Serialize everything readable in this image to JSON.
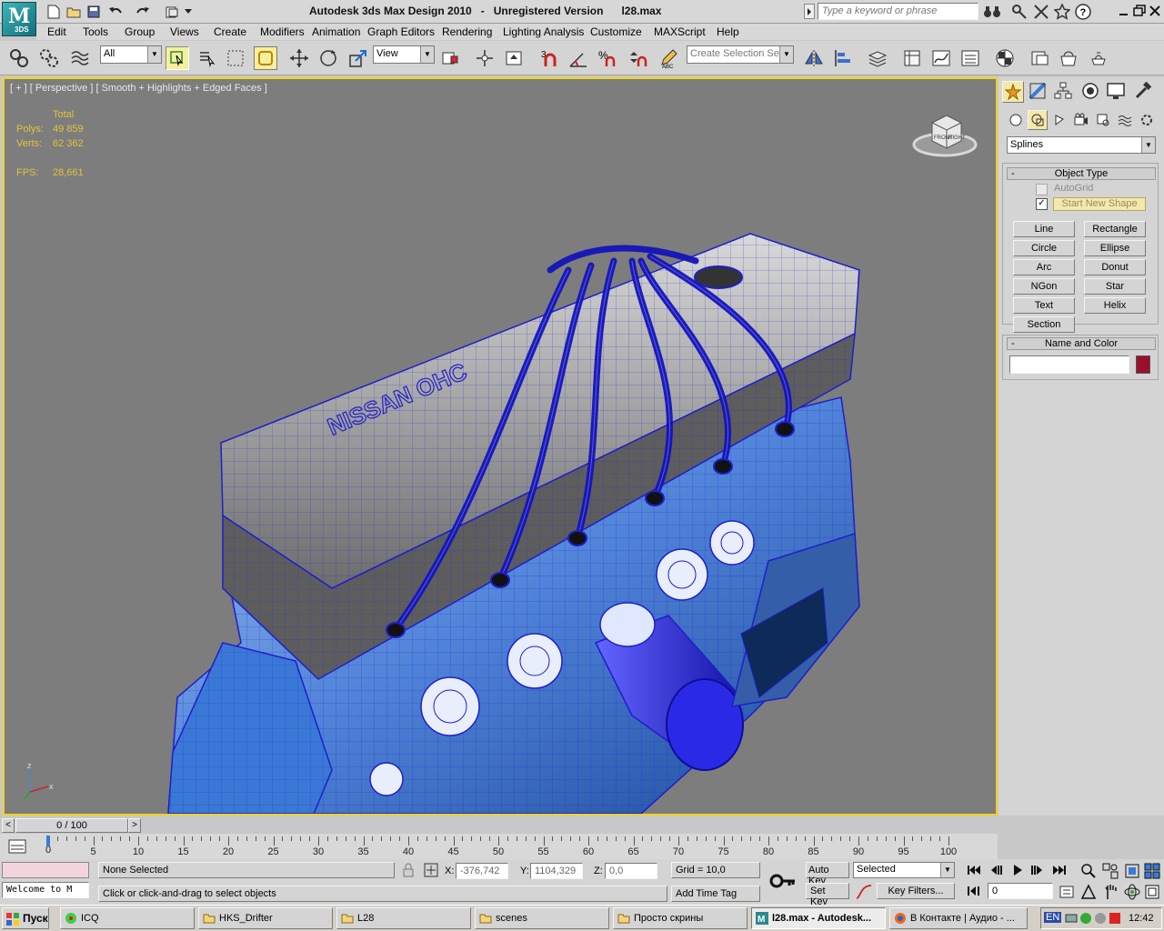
{
  "window": {
    "title": "Autodesk 3ds Max Design 2010   -   Unregistered Version      l28.max",
    "logo_text": "M",
    "logo_sub": "3DS",
    "search_placeholder": "Type a keyword or phrase"
  },
  "menu": [
    "Edit",
    "Tools",
    "Group",
    "Views",
    "Create",
    "Modifiers",
    "Animation",
    "Graph Editors",
    "Rendering",
    "Lighting Analysis",
    "Customize",
    "MAXScript",
    "Help"
  ],
  "toolbar": {
    "selection_filter": "All",
    "ref_coord": "View",
    "named_selection_placeholder": "Create Selection Se",
    "snap_3": "3",
    "angle_snap": "%"
  },
  "viewport": {
    "label": "[ + ] [ Perspective ] [ Smooth + Highlights + Edged Faces ]",
    "stats": {
      "total_label": "Total",
      "polys_label": "Polys:",
      "polys": "49 859",
      "verts_label": "Verts:",
      "verts": "62 362",
      "fps_label": "FPS:",
      "fps": "28,661"
    },
    "model_text": "NISSAN OHC",
    "axis_z": "z",
    "axis_x": "x",
    "viewcube_front": "FRONT",
    "viewcube_right": "RIGHT"
  },
  "command_panel": {
    "category": "Splines",
    "object_type_title": "Object Type",
    "autogrid": "AutoGrid",
    "start_new_shape": "Start New Shape",
    "buttons": [
      "Line",
      "Rectangle",
      "Circle",
      "Ellipse",
      "Arc",
      "Donut",
      "NGon",
      "Star",
      "Text",
      "Helix",
      "Section"
    ],
    "name_color_title": "Name and Color",
    "object_name": "",
    "object_color": "#9a0f2c"
  },
  "timeline": {
    "frame_display": "0 / 100",
    "ticks": [
      "0",
      "5",
      "10",
      "15",
      "20",
      "25",
      "30",
      "35",
      "40",
      "45",
      "50",
      "55",
      "60",
      "65",
      "70",
      "75",
      "80",
      "85",
      "90",
      "95",
      "100"
    ]
  },
  "status": {
    "maxscript_listener": "Welcome to M",
    "selection": "None Selected",
    "prompt": "Click or click-and-drag to select objects",
    "x_label": "X:",
    "x_value": "-376,742",
    "y_label": "Y:",
    "y_value": "1104,329",
    "z_label": "Z:",
    "z_value": "0,0",
    "grid": "Grid = 10,0",
    "add_time_tag": "Add Time Tag",
    "auto_key": "Auto Key",
    "set_key": "Set Key",
    "key_mode": "Selected",
    "key_filters": "Key Filters...",
    "current_frame": "0"
  },
  "taskbar": {
    "start": "Пуск",
    "tasks": [
      "ICQ",
      "HKS_Drifter",
      "L28",
      "scenes",
      "Просто скрины",
      "l28.max - Autodesk...",
      "В Контакте | Аудио - ..."
    ],
    "lang": "EN",
    "clock": "12:42"
  },
  "colors": {
    "viewport_bg": "#7d7d7d",
    "active_border": "#f2d31c",
    "stats_text": "#e4c23a",
    "wire_blue": "#1e1ecc"
  }
}
